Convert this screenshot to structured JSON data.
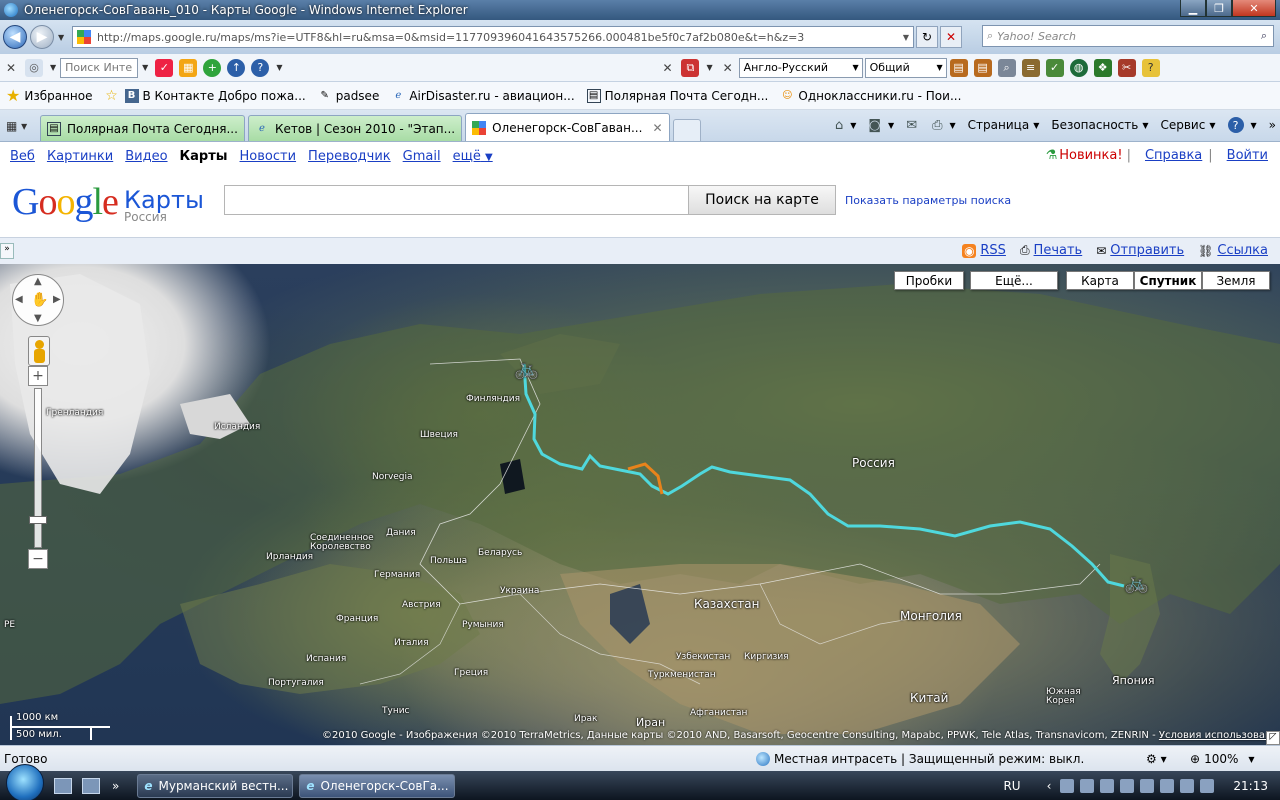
{
  "window": {
    "title": "Оленегорск-СовГавань_010 - Карты Google - Windows Internet Explorer",
    "url": "http://maps.google.ru/maps/ms?ie=UTF8&hl=ru&msa=0&msid=117709396041643575266.000481be5f0c7af2b080e&t=h&z=3",
    "search_placeholder": "Yahoo! Search"
  },
  "toolbar": {
    "search_placeholder": "Поиск Инте",
    "translate_dir": "Англо-Русский",
    "translate_mode": "Общий"
  },
  "favorites": {
    "label": "Избранное",
    "items": [
      "В Контакте  Добро пожа...",
      "padsee",
      "AirDisaster.ru - авиацион...",
      "Полярная Почта Сегодн...",
      "Одноклассники.ru - Пои..."
    ]
  },
  "tabs": [
    {
      "label": "Полярная Почта Сегодня..."
    },
    {
      "label": "Кетов | Сезон 2010 - \"Этап..."
    },
    {
      "label": "Оленегорск-СовГаван..."
    }
  ],
  "commandbar": {
    "page": "Страница",
    "safety": "Безопасность",
    "tools": "Сервис"
  },
  "google_bar": {
    "links": [
      "Веб",
      "Картинки",
      "Видео",
      "Карты",
      "Новости",
      "Переводчик",
      "Gmail",
      "ещё"
    ],
    "current": "Карты",
    "new_label": "Новинка!",
    "help": "Справка",
    "signin": "Войти"
  },
  "header": {
    "logo_text": "Google",
    "product": "Карты",
    "region": "Россия",
    "search_value": "",
    "search_button": "Поиск на карте",
    "search_options": "Показать параметры поиска"
  },
  "map_links": {
    "rss": "RSS",
    "print": "Печать",
    "send": "Отправить",
    "link": "Ссылка"
  },
  "map_controls": {
    "traffic": "Пробки",
    "more": "Ещё...",
    "map": "Карта",
    "satellite": "Спутник",
    "earth": "Земля",
    "selected": "Спутник",
    "scale_km": "1000 км",
    "scale_mi": "500 мил."
  },
  "map_labels": {
    "greenland": "Гренландия",
    "iceland": "Исландия",
    "finland": "Финляндия",
    "sweden": "Швеция",
    "norway": "Norvegia",
    "russia": "Россия",
    "uk": "Соединенное Королевство",
    "ireland": "Ирландия",
    "denmark": "Дания",
    "belarus": "Беларусь",
    "poland": "Польша",
    "germany": "Германия",
    "ukraine": "Украина",
    "austria": "Австрия",
    "france": "Франция",
    "romania": "Румыния",
    "italy": "Италия",
    "spain": "Испания",
    "portugal": "Португалия",
    "greece": "Греция",
    "kazakhstan": "Казахстан",
    "mongolia": "Монголия",
    "uzbekistan": "Узбекистан",
    "kyrgyzstan": "Киргизия",
    "turkmenistan": "Туркменистан",
    "china": "Китай",
    "japan": "Япония",
    "south_korea": "Южная Корея",
    "afghanistan": "Афганистан",
    "iraq": "Ирак",
    "iran": "Иран",
    "tunisia": "Тунис",
    "pe": "PE"
  },
  "copyright": "©2010 Google - Изображения ©2010 TerraMetrics, Данные карты ©2010 AND, Basarsoft, Geocentre Consulting, Mapabc, PPWK, Tele Atlas, Transnavicom, ZENRIN -",
  "terms": "Условия использования",
  "status": {
    "ready": "Готово",
    "zone": "Местная интрасеть | Защищенный режим: выкл.",
    "zoom": "100%"
  },
  "taskbar": {
    "items": [
      "Мурманский вестн...",
      "Оленегорск-СовГа..."
    ],
    "lang": "RU",
    "time": "21:13"
  },
  "colors": {
    "route_main": "#4fd8dd",
    "route_alt": "#e8831b",
    "link": "#1a3fc4"
  }
}
